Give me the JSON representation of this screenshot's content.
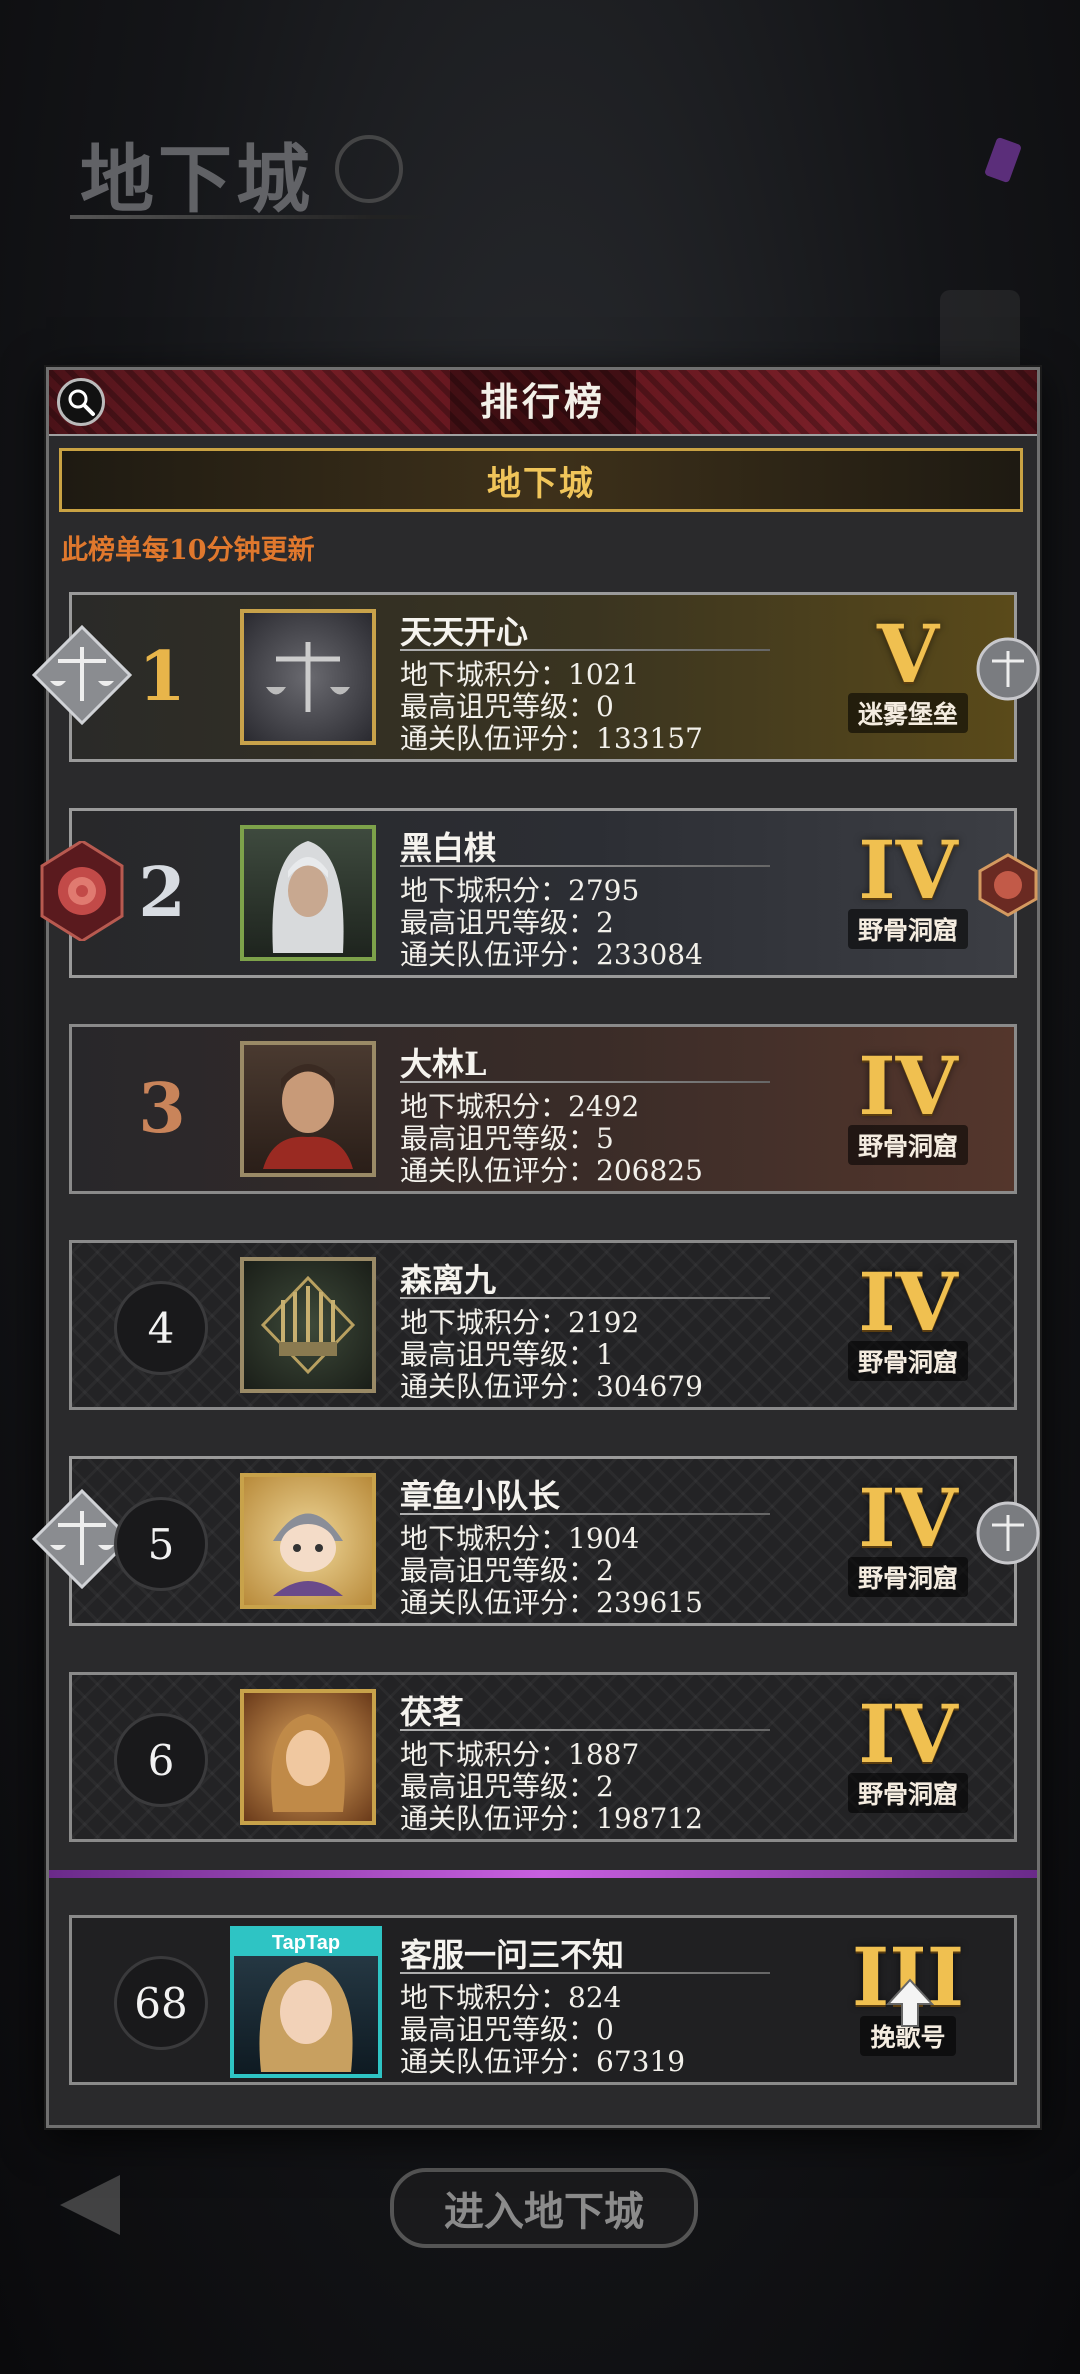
{
  "background": {
    "title": "地下城",
    "enter_button": "进入地下城"
  },
  "panel": {
    "title": "排行榜",
    "tab_label": "地下城",
    "update_note": "此榜单每10分钟更新"
  },
  "labels": {
    "score": "地下城积分：",
    "curse": "最高诅咒等级：",
    "team": "通关队伍评分："
  },
  "rows": [
    {
      "rank": "1",
      "name": "天天开心",
      "score": "1021",
      "curse": "0",
      "team": "133157",
      "tier": "V",
      "tier_name": "迷雾堡垒"
    },
    {
      "rank": "2",
      "name": "黑白棋",
      "score": "2795",
      "curse": "2",
      "team": "233084",
      "tier": "IV",
      "tier_name": "野骨洞窟"
    },
    {
      "rank": "3",
      "name": "大林L",
      "score": "2492",
      "curse": "5",
      "team": "206825",
      "tier": "IV",
      "tier_name": "野骨洞窟"
    },
    {
      "rank": "4",
      "name": "森离九",
      "score": "2192",
      "curse": "1",
      "team": "304679",
      "tier": "IV",
      "tier_name": "野骨洞窟"
    },
    {
      "rank": "5",
      "name": "章鱼小队长",
      "score": "1904",
      "curse": "2",
      "team": "239615",
      "tier": "IV",
      "tier_name": "野骨洞窟"
    },
    {
      "rank": "6",
      "name": "茯茗",
      "score": "1887",
      "curse": "2",
      "team": "198712",
      "tier": "IV",
      "tier_name": "野骨洞窟"
    }
  ],
  "self_row": {
    "rank": "68",
    "name": "客服一问三不知",
    "score": "824",
    "curse": "0",
    "team": "67319",
    "tier": "III",
    "tier_name": "挽歌号",
    "avatar_badge": "TapTap"
  },
  "colors": {
    "gold": "#f0c050",
    "note": "#e0782d",
    "panel_header": "#7a1f28",
    "tab_border": "#c9a243"
  }
}
